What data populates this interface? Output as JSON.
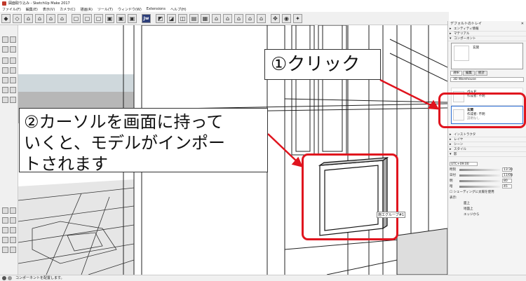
{
  "window": {
    "title": "図面取り込み - SketchUp Make 2017"
  },
  "menu": [
    "ファイル(F)",
    "編集(E)",
    "表示(V)",
    "カメラ(C)",
    "描画(R)",
    "ツール(T)",
    "ウィンドウ(W)",
    "Extensions",
    "ヘルプ(H)"
  ],
  "toolbar": {
    "jw_label": "Jw"
  },
  "callouts": {
    "step1": "①クリック",
    "step2_line1": "②カーソルを画面に持って",
    "step2_line2": "いくと、モデルがインポー",
    "step2_line3": "トされます"
  },
  "viewport": {
    "component_tag": "施工グループ#1"
  },
  "tray": {
    "title": "デフォルトのトレイ",
    "panels": [
      "エンティティ情報",
      "マテリアル",
      "コンポーネント"
    ],
    "selected_name": "玄関",
    "tabs": [
      "選択",
      "編集",
      "統計"
    ],
    "search_placeholder": "3D Warehouse",
    "items": [
      {
        "name": "ベッド",
        "author": "作成者: 不明",
        "note": ""
      },
      {
        "name": "玄関",
        "author": "作成者: 不明",
        "note": "説明なし"
      }
    ],
    "panels_lower": [
      "インストラクタ",
      "レイヤ",
      "シーン",
      "スタイル",
      "影"
    ],
    "timezone": "UTC+09:00",
    "time_label": "時刻",
    "time_value": "13:30",
    "date_label": "日付",
    "date_value": "11/08",
    "light_label": "明",
    "light_value": "80",
    "dark_label": "暗",
    "dark_value": "45",
    "sun_checkbox": "シェーディングに太陽を使用",
    "display_label": "表示:",
    "display_opts": [
      "面上",
      "地面上",
      "エッジから"
    ]
  },
  "status": {
    "text": "コンポーネントを配置します。"
  },
  "colors": {
    "highlight_red": "#e0141e",
    "selection_blue": "#2c6fd6"
  }
}
